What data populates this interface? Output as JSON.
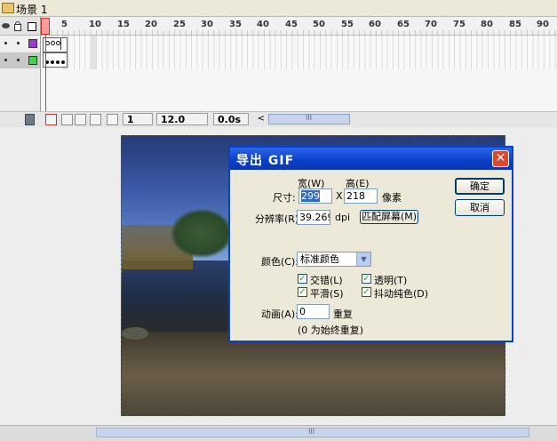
{
  "scene": {
    "label": "场景 1"
  },
  "timeline": {
    "ruler_numbers": [
      "1",
      "5",
      "10",
      "15",
      "20",
      "25",
      "30",
      "35",
      "40",
      "45",
      "50",
      "55",
      "60",
      "65",
      "70",
      "75",
      "80",
      "85",
      "90"
    ],
    "current_frame": "1",
    "frame_rate": "12.0 fps",
    "elapsed_time": "0.0s",
    "grip": "III",
    "scroll_left": "<",
    "layer_colors": [
      "#9a3bd0",
      "#3fd44a"
    ]
  },
  "stage": {
    "grip": "III"
  },
  "dialog": {
    "title": "导出 GIF",
    "close_glyph": "✕",
    "width_header": "宽(W)",
    "height_header": "高(E)",
    "size_label": "尺寸:",
    "width_value": "299",
    "x_sep": "X",
    "height_value": "218",
    "pixels_unit": "像素",
    "resolution_label": "分辨率(R):",
    "resolution_value": "39.2699",
    "dpi_unit": "dpi",
    "match_screen_button": "匹配屏幕(M)",
    "ok_button": "确定",
    "cancel_button": "取消",
    "colors_label": "颜色(C):",
    "colors_value": "标准颜色",
    "interlace_label": "交错(L)",
    "transparent_label": "透明(T)",
    "smooth_label": "平滑(S)",
    "dither_label": "抖动纯色(D)",
    "animation_label": "动画(A):",
    "animation_value": "0",
    "repeat_label": "重复",
    "repeat_hint": "(0 为始终重复)",
    "check_glyph": "✓"
  }
}
